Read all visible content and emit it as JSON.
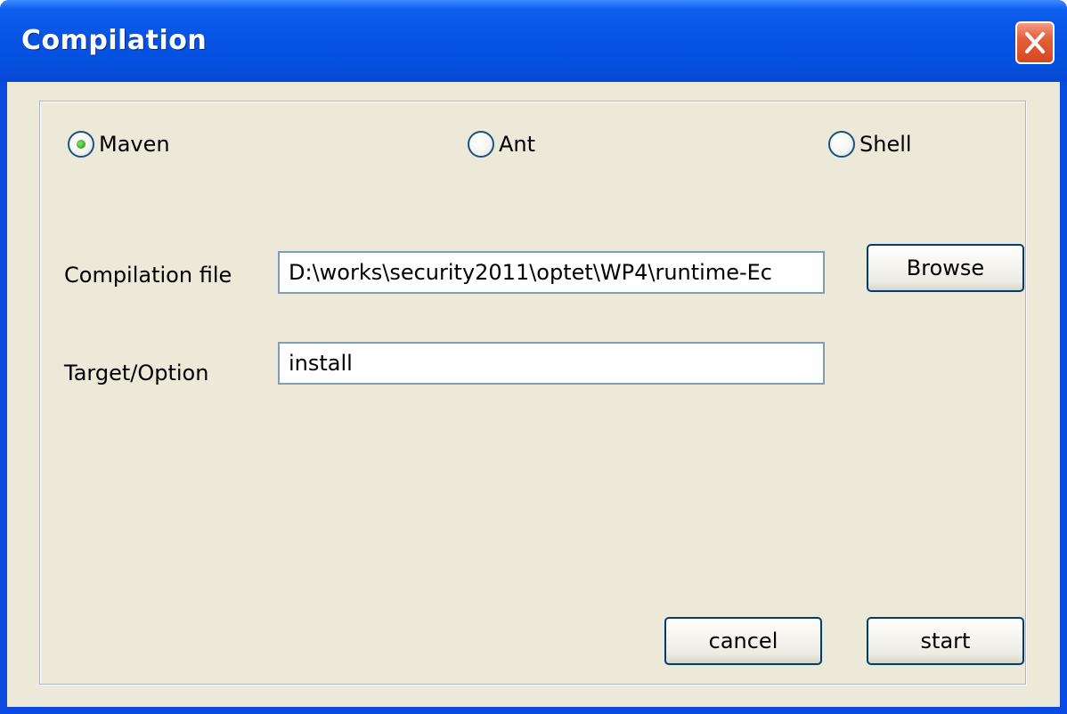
{
  "window": {
    "title": "Compilation"
  },
  "build_type": {
    "options": [
      {
        "label": "Maven",
        "selected": true
      },
      {
        "label": "Ant",
        "selected": false
      },
      {
        "label": "Shell",
        "selected": false
      }
    ]
  },
  "form": {
    "compilation_file_label": "Compilation file",
    "compilation_file_value": "D:\\works\\security2011\\optet\\WP4\\runtime-Ec",
    "target_label": "Target/Option",
    "target_value": "install"
  },
  "buttons": {
    "browse": "Browse",
    "cancel": "cancel",
    "start": "start"
  },
  "icons": {
    "close": "close-icon",
    "radio_selected": "radio-selected",
    "radio_unselected": "radio-unselected"
  },
  "colors": {
    "titlebar": "#0753e4",
    "client_background": "#ece9d8",
    "close_button": "#d4481f",
    "radio_dot": "#3fb02a",
    "input_border": "#7f9db9",
    "button_border": "#003c74"
  }
}
